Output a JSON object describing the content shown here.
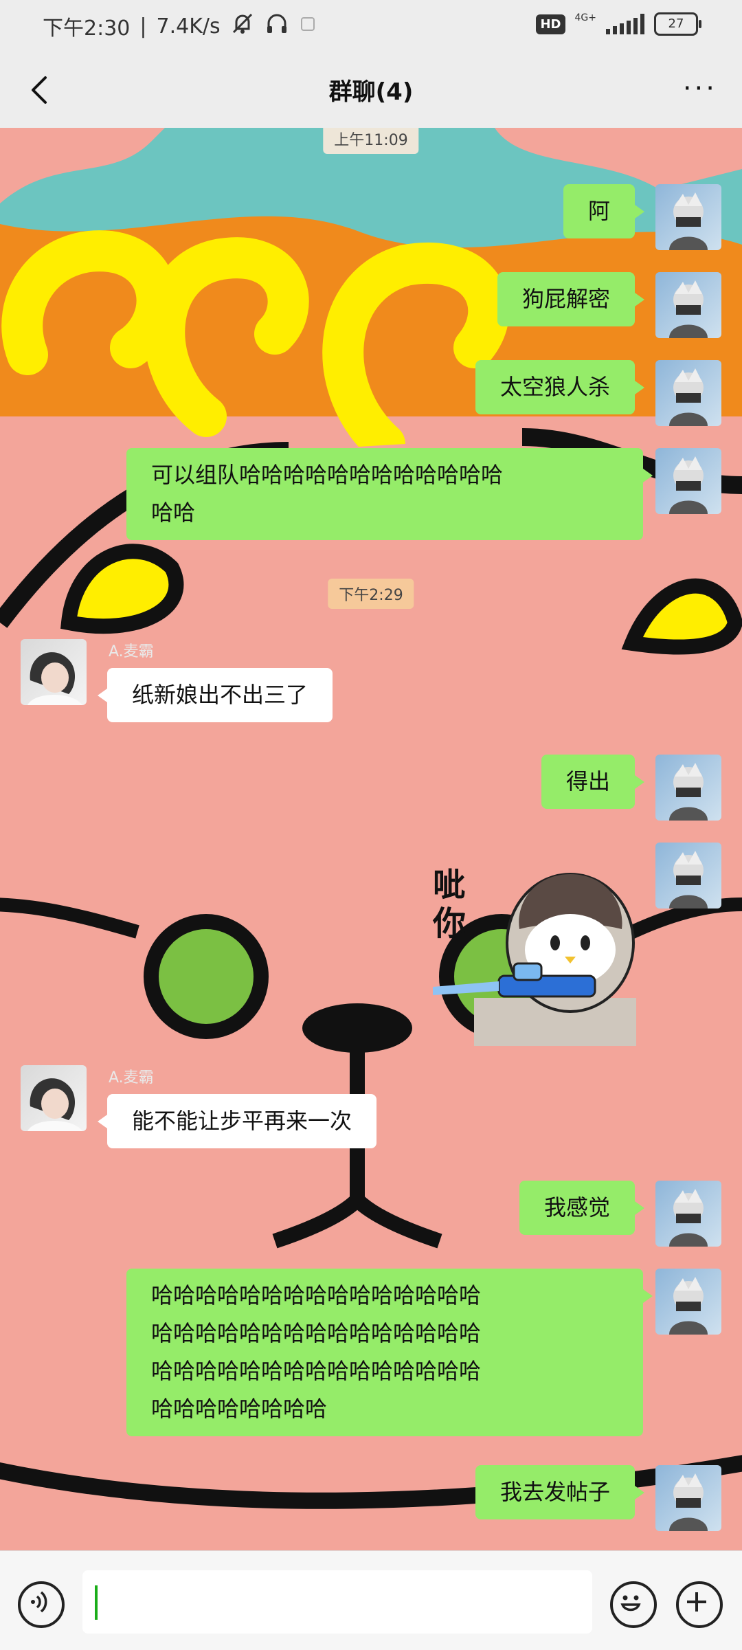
{
  "status_bar": {
    "time": "下午2:30",
    "speed": "7.4K/s",
    "hd_label": "HD",
    "network_label": "4G+",
    "battery": "27"
  },
  "header": {
    "title": "群聊(4)",
    "more_label": "···"
  },
  "messages": [
    {
      "type": "time",
      "text": "上午11:09"
    },
    {
      "type": "text",
      "from": "me",
      "text": "阿"
    },
    {
      "type": "text",
      "from": "me",
      "text": "狗屁解密"
    },
    {
      "type": "text",
      "from": "me",
      "text": "太空狼人杀"
    },
    {
      "type": "text",
      "from": "me",
      "line1": "可以组队哈哈哈哈哈哈哈哈哈哈哈哈",
      "line2": "哈哈"
    },
    {
      "type": "time",
      "text": "下午2:29"
    },
    {
      "type": "text",
      "from": "other",
      "sender": "A.麦霸",
      "text": "纸新娘出不出三了"
    },
    {
      "type": "text",
      "from": "me",
      "text": "得出"
    },
    {
      "type": "sticker",
      "from": "me",
      "sticker_text": "呲你",
      "sticker_name": "penguin-water-gun-sticker"
    },
    {
      "type": "text",
      "from": "other",
      "sender": "A.麦霸",
      "text": "能不能让步平再来一次"
    },
    {
      "type": "text",
      "from": "me",
      "text": "我感觉"
    },
    {
      "type": "text",
      "from": "me",
      "line1": "哈哈哈哈哈哈哈哈哈哈哈哈哈哈哈",
      "line2": "哈哈哈哈哈哈哈哈哈哈哈哈哈哈哈",
      "line3": "哈哈哈哈哈哈哈哈哈哈哈哈哈哈哈",
      "line4": "哈哈哈哈哈哈哈哈"
    },
    {
      "type": "text",
      "from": "me",
      "text": "我去发帖子"
    }
  ],
  "input": {
    "value": "",
    "voice_icon": "voice-icon",
    "emoji_icon": "emoji-icon",
    "plus_icon": "plus-icon"
  },
  "colors": {
    "my_bubble": "#95ec69",
    "other_bubble": "#ffffff",
    "bar_background": "#ededed",
    "wallpaper": "#f3a59a"
  }
}
